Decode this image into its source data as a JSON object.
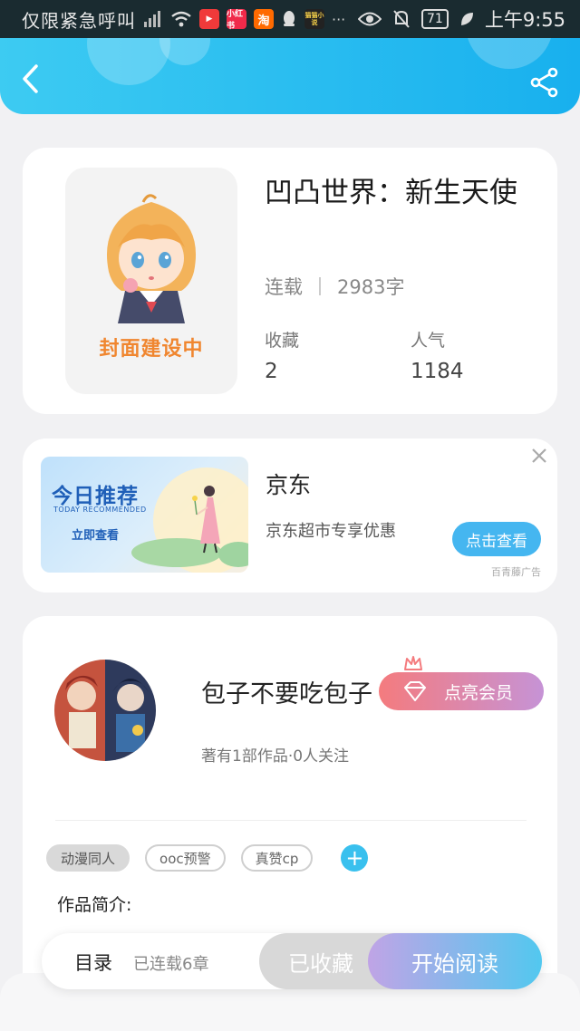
{
  "status_bar": {
    "carrier": "仅限紧急呼叫",
    "app_badges": [
      "小红书",
      "淘",
      "猫猫小说"
    ],
    "battery": "71",
    "time": "上午9:55"
  },
  "header": {
    "back_icon": "back-arrow-icon",
    "share_icon": "share-icon"
  },
  "book": {
    "cover_text": "封面建设中",
    "title": "凹凸世界：新生天使",
    "status": "连载",
    "word_count": "2983字",
    "stats": [
      {
        "label": "收藏",
        "value": "2"
      },
      {
        "label": "人气",
        "value": "1184"
      }
    ]
  },
  "ad": {
    "banner_title": "今日推荐",
    "banner_sub": "TODAY RECOMMENDED",
    "banner_button": "立即查看",
    "title": "京东",
    "description": "京东超市专享优惠",
    "cta": "点击查看",
    "source": "百青藤广告"
  },
  "author": {
    "name": "包子不要吃包子",
    "vip_button": "点亮会员",
    "info": "著有1部作品·0人关注",
    "tags": [
      "动漫同人",
      "ooc预警",
      "真赞cp"
    ],
    "add_tag": "+",
    "intro_label": "作品简介:"
  },
  "bottom_bar": {
    "toc": "目录",
    "chapters": "已连载6章",
    "favorite": "已收藏",
    "read": "开始阅读"
  },
  "colors": {
    "header_start": "#3dcbf2",
    "header_end": "#18b0ee",
    "cover_text": "#f0862f",
    "cta_blue": "#45b6f0",
    "vip_start": "#f47b7e",
    "vip_end": "#c693d6",
    "tag_add": "#39c0ee"
  }
}
